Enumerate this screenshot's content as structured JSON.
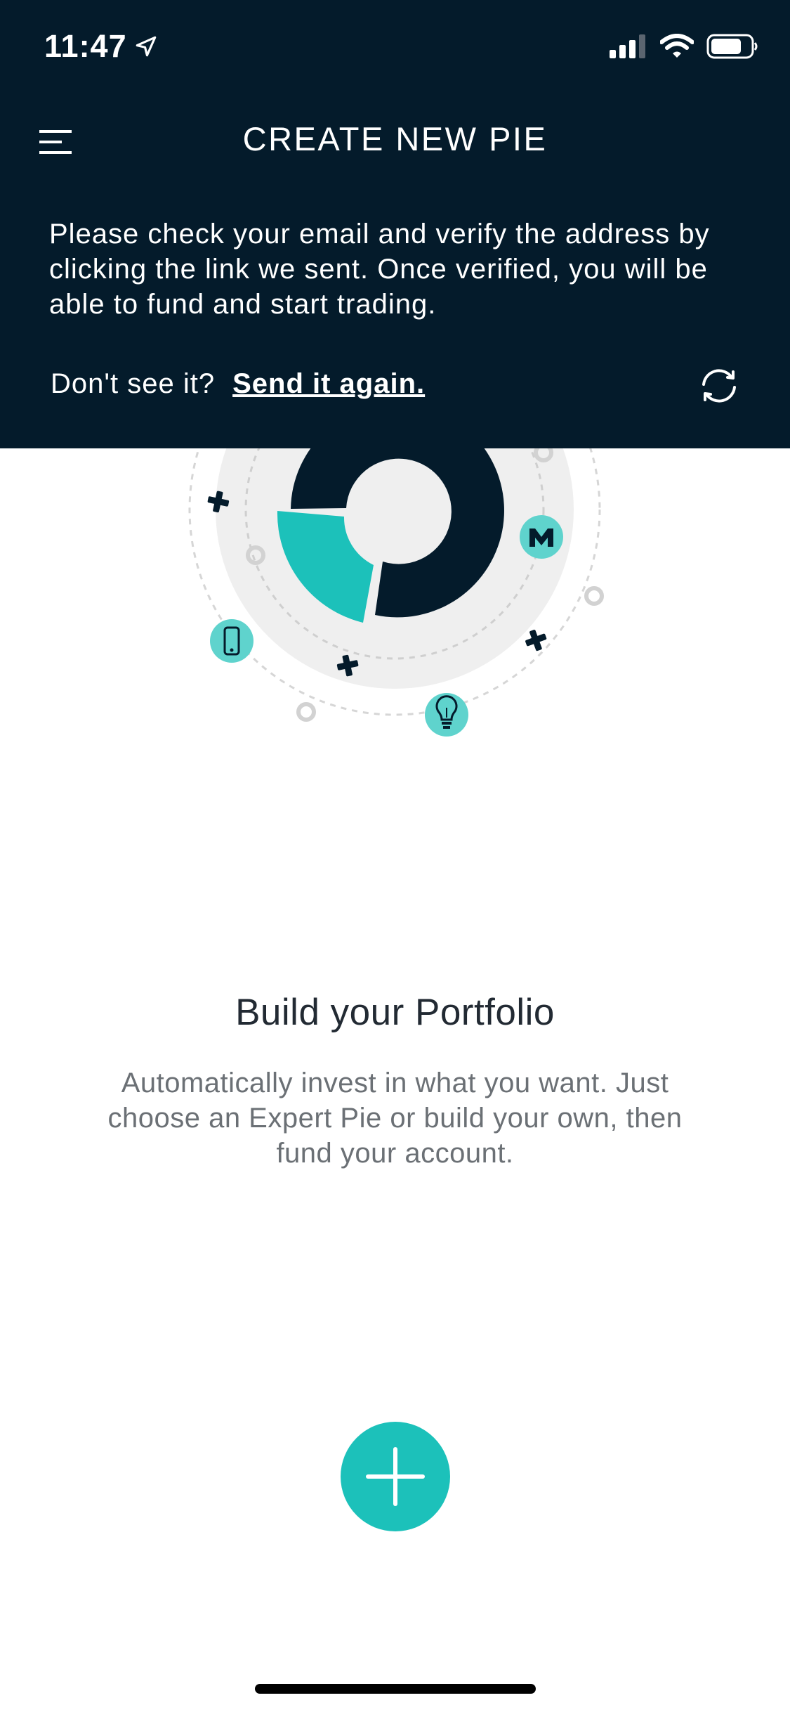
{
  "status_bar": {
    "time": "11:47",
    "icons": [
      "location-arrow-icon",
      "signal-icon",
      "wifi-icon",
      "battery-icon"
    ]
  },
  "header": {
    "title": "CREATE NEW PIE",
    "menu_icon": "hamburger-menu-icon",
    "verify_message": "Please check your email and verify the address by clicking the link we sent. Once verified, you will be able to fund and start trading.",
    "resend_prompt": "Don't see it?",
    "resend_link": "Send it again.",
    "refresh_icon": "refresh-icon"
  },
  "illustration": {
    "icons": [
      "phone-icon",
      "lightbulb-icon",
      "m-logo-icon",
      "plus-mark-icon"
    ]
  },
  "main": {
    "title": "Build your Portfolio",
    "description": "Automatically invest in what you want. Just choose an Expert Pie or build your own, then fund your account."
  },
  "fab": {
    "icon": "plus-icon"
  },
  "colors": {
    "header_bg": "#041b2b",
    "teal": "#1cc1ba",
    "teal_light": "#5fd3cd",
    "navy": "#041b2b",
    "gray_circle": "#efefef"
  }
}
